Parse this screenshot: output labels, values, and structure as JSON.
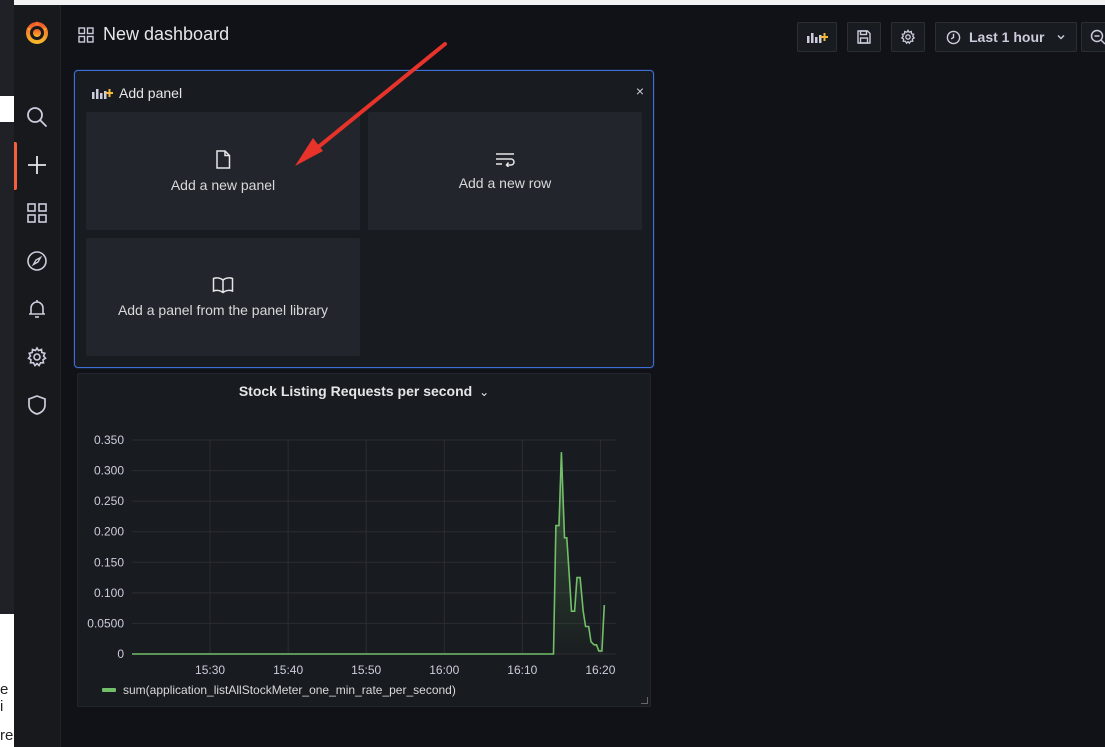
{
  "background": {
    "left_text_1": "e i",
    "left_text_2": "re"
  },
  "dashboard": {
    "title": "New dashboard"
  },
  "toolbar": {
    "time_range": "Last 1 hour"
  },
  "add_panel": {
    "title": "Add panel",
    "close": "×",
    "options": [
      {
        "label": "Add a new panel",
        "icon": "file-icon"
      },
      {
        "label": "Add a new row",
        "icon": "row-icon"
      },
      {
        "label": "Add a panel from the panel library",
        "icon": "book-icon"
      }
    ]
  },
  "panel": {
    "title": "Stock Listing Requests per second",
    "chevron": "⌄"
  },
  "colors": {
    "accent": "#3d71d9",
    "series": "#73bf69",
    "active": "#f55f3e",
    "arrow": "#e8332b"
  },
  "chart_data": {
    "type": "area",
    "ylim": [
      0,
      0.35
    ],
    "yticks": [
      "0",
      "0.0500",
      "0.100",
      "0.150",
      "0.200",
      "0.250",
      "0.300",
      "0.350"
    ],
    "xticks": [
      "15:30",
      "15:40",
      "15:50",
      "16:00",
      "16:10",
      "16:20"
    ],
    "xrange_minutes": [
      15.3333,
      16.3667
    ],
    "series": [
      {
        "name": "sum(application_listAllStockMeter_one_min_rate_per_second)",
        "points": [
          [
            "15:20",
            0
          ],
          [
            "16:14",
            0
          ],
          [
            "16:14.3",
            0.21
          ],
          [
            "16:14.7",
            0.21
          ],
          [
            "16:15",
            0.33
          ],
          [
            "16:15.4",
            0.19
          ],
          [
            "16:15.7",
            0.19
          ],
          [
            "16:16",
            0.13
          ],
          [
            "16:16.3",
            0.07
          ],
          [
            "16:16.7",
            0.07
          ],
          [
            "16:17",
            0.125
          ],
          [
            "16:17.4",
            0.125
          ],
          [
            "16:17.8",
            0.07
          ],
          [
            "16:18.1",
            0.045
          ],
          [
            "16:18.5",
            0.045
          ],
          [
            "16:18.8",
            0.02
          ],
          [
            "16:19.2",
            0.015
          ],
          [
            "16:19.5",
            0.015
          ],
          [
            "16:19.8",
            0.005
          ],
          [
            "16:20.2",
            0.005
          ],
          [
            "16:20.5",
            0.08
          ]
        ]
      }
    ]
  }
}
